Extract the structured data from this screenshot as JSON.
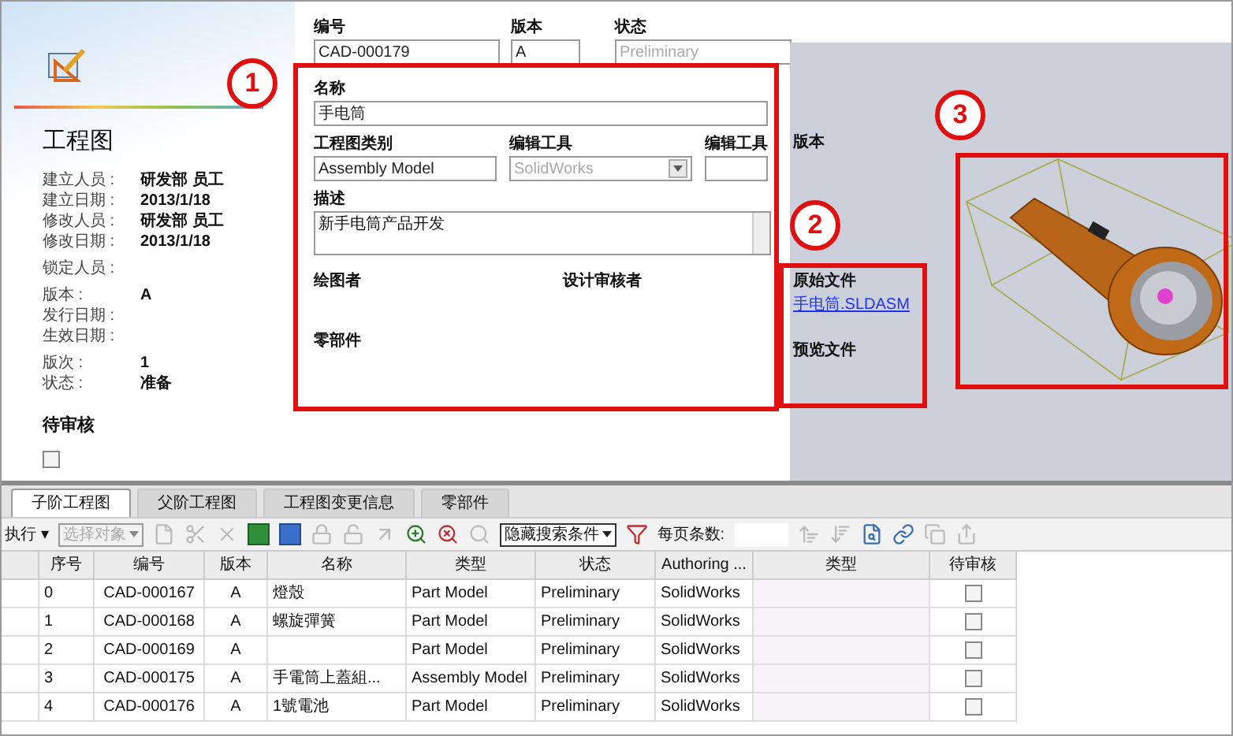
{
  "summary": {
    "title": "工程图",
    "groups": [
      [
        {
          "label": "建立人员 :",
          "value": "研发部 员工"
        },
        {
          "label": "建立日期 :",
          "value": "2013/1/18"
        },
        {
          "label": "修改人员 :",
          "value": "研发部 员工"
        },
        {
          "label": "修改日期 :",
          "value": "2013/1/18"
        }
      ],
      [
        {
          "label": "锁定人员 :"
        }
      ],
      [
        {
          "label": "版本 :",
          "value": "A"
        },
        {
          "label": "发行日期 :"
        },
        {
          "label": "生效日期 :"
        }
      ],
      [
        {
          "label": "版次 :",
          "value": "1"
        },
        {
          "label": "状态 :",
          "value": "准备"
        }
      ]
    ],
    "pending": {
      "label": "待审核",
      "checked": false
    }
  },
  "form": {
    "number": {
      "label": "编号",
      "value": "CAD-000179"
    },
    "revision": {
      "label": "版本",
      "value": "A"
    },
    "state": {
      "label": "状态",
      "value": "Preliminary",
      "disabled": true
    },
    "name": {
      "label": "名称",
      "value": "手电筒"
    },
    "drawing_type": {
      "label": "工程图类别",
      "value": "Assembly Model"
    },
    "authoring_tool": {
      "label": "编辑工具",
      "value": "SolidWorks",
      "disabled": true
    },
    "tool_version": {
      "label": "编辑工具",
      "label_tail": "版本"
    },
    "description": {
      "label": "描述",
      "value": "新手电筒产品开发"
    },
    "drafter": {
      "label": "绘图者"
    },
    "reviewer": {
      "label": "设计审核者"
    },
    "parts": {
      "label": "零部件"
    }
  },
  "files": {
    "original_label": "原始文件",
    "original_link": "手电筒.SLDASM",
    "preview_label": "预览文件"
  },
  "callouts": [
    "1",
    "2",
    "3"
  ],
  "tabs": [
    {
      "label": "子阶工程图",
      "selected": true
    },
    {
      "label": "父阶工程图",
      "selected": false
    },
    {
      "label": "工程图变更信息",
      "selected": false
    },
    {
      "label": "零部件",
      "selected": false
    }
  ],
  "toolbar": {
    "run": "执行",
    "run_caret": "▾",
    "select_object": "选择对象",
    "hide_search": "隐藏搜索条件",
    "page_size_label": "每页条数:"
  },
  "table": {
    "columns": [
      "序号",
      "编号",
      "版本",
      "名称",
      "类型",
      "状态",
      "Authoring ...",
      "类型",
      "待审核"
    ],
    "rows": [
      {
        "cells": [
          "0",
          "CAD-000167",
          "A",
          "燈殼",
          "Part Model",
          "Preliminary",
          "SolidWorks",
          ""
        ],
        "pending": false
      },
      {
        "cells": [
          "1",
          "CAD-000168",
          "A",
          "螺旋彈簧",
          "Part Model",
          "Preliminary",
          "SolidWorks",
          ""
        ],
        "pending": false
      },
      {
        "cells": [
          "2",
          "CAD-000169",
          "A",
          "",
          "Part Model",
          "Preliminary",
          "SolidWorks",
          ""
        ],
        "pending": false
      },
      {
        "cells": [
          "3",
          "CAD-000175",
          "A",
          "手電筒上蓋組...",
          "Assembly Model",
          "Preliminary",
          "SolidWorks",
          ""
        ],
        "pending": false
      },
      {
        "cells": [
          "4",
          "CAD-000176",
          "A",
          "1號電池",
          "Part Model",
          "Preliminary",
          "SolidWorks",
          ""
        ],
        "pending": false
      }
    ]
  }
}
